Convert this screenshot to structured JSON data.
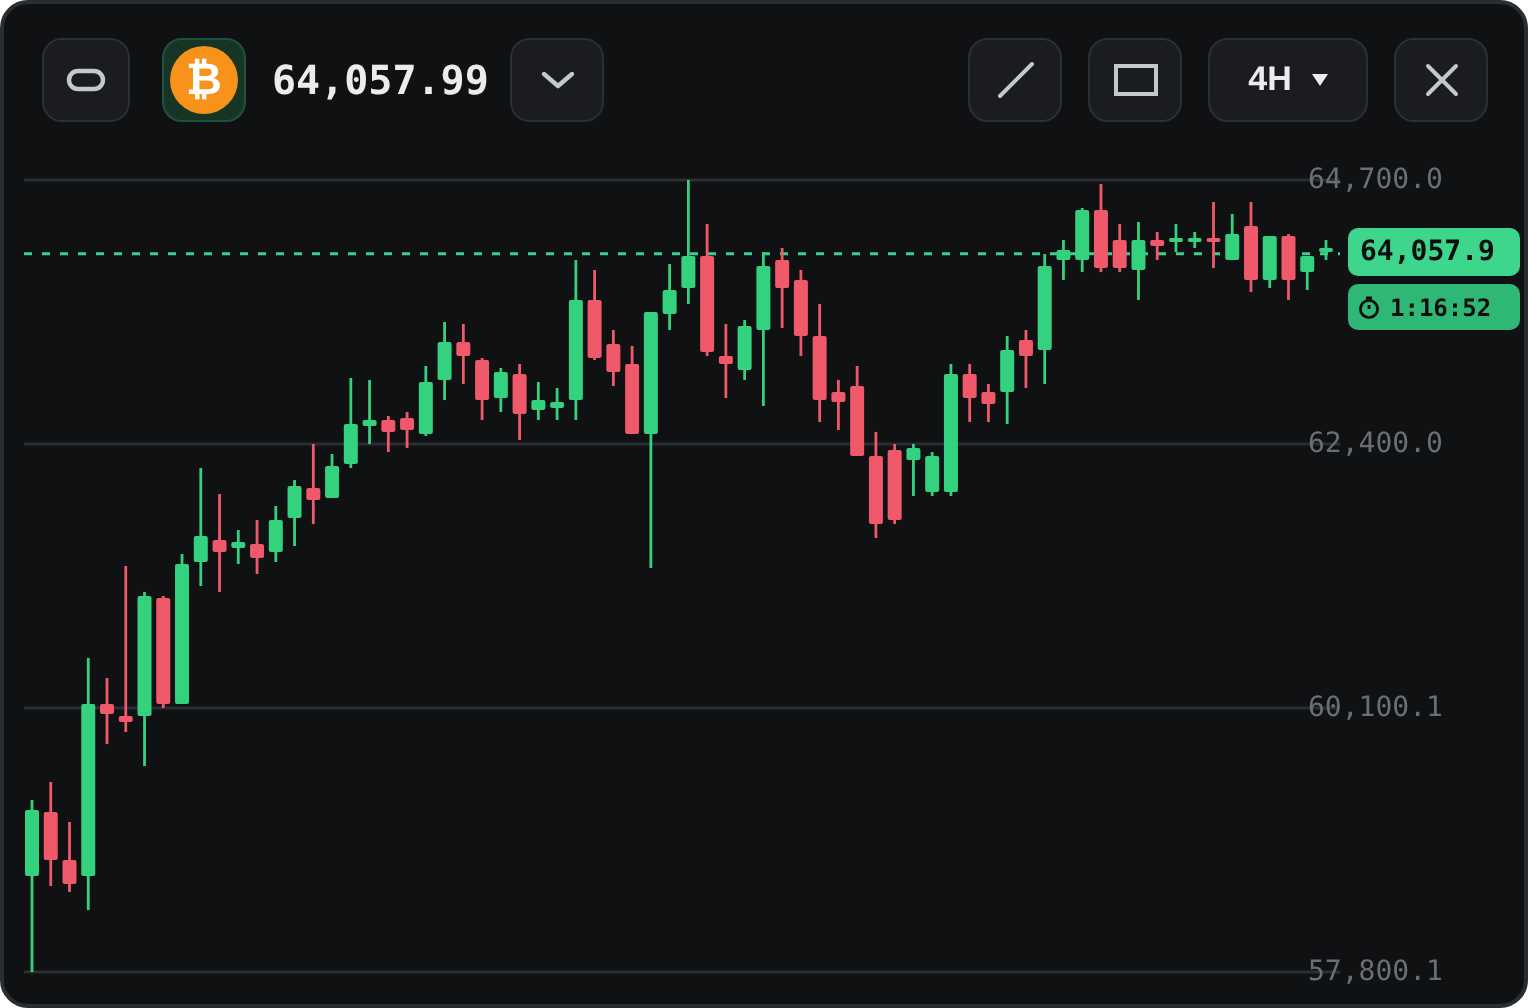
{
  "toolbar": {
    "coin_symbol": "₿",
    "price": "64,057.99",
    "interval": "4H"
  },
  "chart": {
    "price_badge": "64,057.9",
    "countdown": "1:16:52",
    "chart_data": {
      "type": "candlestick",
      "ohlc": [
        [
          58636,
          59298,
          57800,
          59211
        ],
        [
          59194,
          59455,
          58549,
          58776
        ],
        [
          58776,
          59107,
          58497,
          58567
        ],
        [
          58636,
          60536,
          58340,
          60135
        ],
        [
          60135,
          60361,
          59786,
          60048
        ],
        [
          60030,
          61337,
          59891,
          59978
        ],
        [
          60030,
          61111,
          59595,
          61076
        ],
        [
          61058,
          61076,
          60100,
          60135
        ],
        [
          60135,
          61442,
          60135,
          61355
        ],
        [
          61372,
          62191,
          61163,
          61599
        ],
        [
          61564,
          61964,
          61111,
          61459
        ],
        [
          61494,
          61651,
          61355,
          61546
        ],
        [
          61529,
          61738,
          61267,
          61407
        ],
        [
          61459,
          61860,
          61372,
          61738
        ],
        [
          61755,
          62086,
          61511,
          62034
        ],
        [
          62017,
          62400,
          61703,
          61912
        ],
        [
          61930,
          62313,
          61930,
          62208
        ],
        [
          62226,
          62975,
          62191,
          62574
        ],
        [
          62557,
          62958,
          62400,
          62609
        ],
        [
          62609,
          62644,
          62330,
          62505
        ],
        [
          62627,
          62679,
          62365,
          62522
        ],
        [
          62487,
          63080,
          62470,
          62940
        ],
        [
          62958,
          63463,
          62783,
          63289
        ],
        [
          63289,
          63445,
          62923,
          63167
        ],
        [
          63132,
          63149,
          62609,
          62783
        ],
        [
          62801,
          63062,
          62679,
          63027
        ],
        [
          63010,
          63097,
          62435,
          62661
        ],
        [
          62696,
          62940,
          62609,
          62783
        ],
        [
          62714,
          62888,
          62609,
          62766
        ],
        [
          62783,
          64003,
          62609,
          63655
        ],
        [
          63655,
          63916,
          63132,
          63149
        ],
        [
          63271,
          63393,
          62905,
          63027
        ],
        [
          63097,
          63254,
          62487,
          62487
        ],
        [
          62487,
          63550,
          61320,
          63550
        ],
        [
          63533,
          63968,
          63393,
          63742
        ],
        [
          63759,
          64700,
          63620,
          64038
        ],
        [
          64038,
          64317,
          63167,
          63202
        ],
        [
          63167,
          63445,
          62801,
          63097
        ],
        [
          63045,
          63480,
          62958,
          63428
        ],
        [
          63393,
          64073,
          62731,
          63951
        ],
        [
          64003,
          64108,
          63411,
          63759
        ],
        [
          63829,
          63916,
          63167,
          63341
        ],
        [
          63341,
          63620,
          62592,
          62783
        ],
        [
          62853,
          62958,
          62522,
          62766
        ],
        [
          62905,
          63080,
          62296,
          62296
        ],
        [
          62296,
          62505,
          61581,
          61703
        ],
        [
          62348,
          62400,
          61703,
          61738
        ],
        [
          62261,
          62400,
          61947,
          62365
        ],
        [
          61982,
          62330,
          61947,
          62296
        ],
        [
          61982,
          63097,
          61947,
          63010
        ],
        [
          63010,
          63097,
          62592,
          62801
        ],
        [
          62853,
          62923,
          62592,
          62748
        ],
        [
          62853,
          63341,
          62574,
          63219
        ],
        [
          63306,
          63393,
          62888,
          63167
        ],
        [
          63219,
          64055,
          62923,
          63951
        ],
        [
          64003,
          64177,
          63829,
          64090
        ],
        [
          64003,
          64456,
          63898,
          64439
        ],
        [
          64439,
          64665,
          63898,
          63933
        ],
        [
          64177,
          64317,
          63898,
          63933
        ],
        [
          63916,
          64334,
          63655,
          64177
        ],
        [
          64177,
          64247,
          64003,
          64125
        ],
        [
          64160,
          64317,
          64073,
          64195
        ],
        [
          64160,
          64247,
          64108,
          64195
        ],
        [
          64195,
          64508,
          63933,
          64160
        ],
        [
          64003,
          64404,
          64003,
          64230
        ],
        [
          64299,
          64508,
          63724,
          63829
        ],
        [
          63829,
          64212,
          63759,
          64212
        ],
        [
          64212,
          64230,
          63655,
          63829
        ],
        [
          63898,
          64038,
          63742,
          64038
        ],
        [
          64073,
          64177,
          64003,
          64108
        ]
      ],
      "yticks": [
        {
          "value": 64700,
          "label": "64,700.0"
        },
        {
          "value": 62400,
          "label": "62,400.0"
        },
        {
          "value": 60100.1,
          "label": "60,100.1"
        },
        {
          "value": 57800.1,
          "label": "57,800.1"
        }
      ],
      "ylim": [
        57800.1,
        64700
      ],
      "grid": true,
      "ref_lines": [
        {
          "axis": "y",
          "value": 64057.99
        }
      ]
    }
  }
}
